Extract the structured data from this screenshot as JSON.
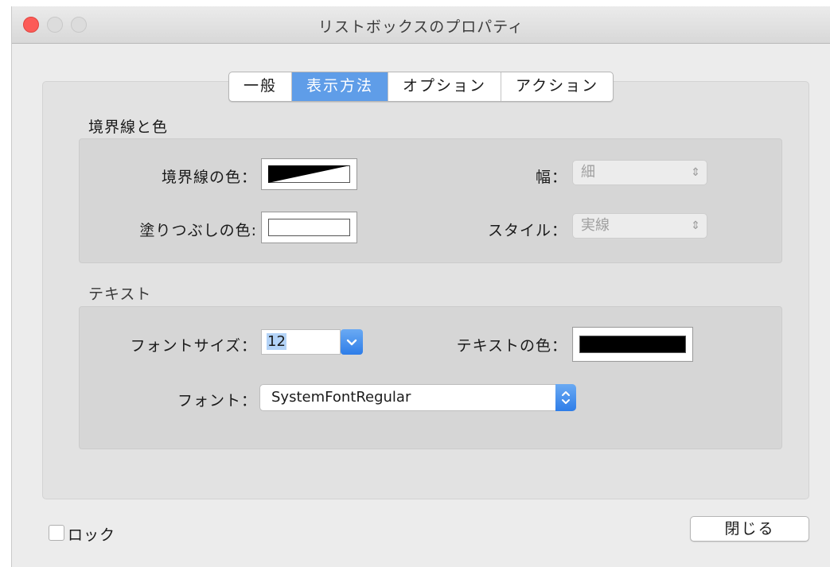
{
  "window": {
    "title": "リストボックスのプロパティ"
  },
  "tabs": [
    {
      "label": "一般",
      "active": false
    },
    {
      "label": "表示方法",
      "active": true
    },
    {
      "label": "オプション",
      "active": false
    },
    {
      "label": "アクション",
      "active": false
    }
  ],
  "border_section": {
    "title": "境界線と色",
    "border_color_label": "境界線の色：",
    "fill_color_label": "塗りつぶしの色:",
    "width_label": "幅：",
    "width_value": "細",
    "style_label": "スタイル：",
    "style_value": "実線"
  },
  "text_section": {
    "title": "テキスト",
    "font_size_label": "フォントサイズ：",
    "font_size_value": "12",
    "text_color_label": "テキストの色：",
    "text_color": "#000000",
    "font_label": "フォント：",
    "font_value": "SystemFontRegular"
  },
  "footer": {
    "lock_label": "ロック",
    "close_label": "閉じる"
  },
  "colors": {
    "accent": "#5f9de8",
    "close_light": "#fc5b57"
  }
}
